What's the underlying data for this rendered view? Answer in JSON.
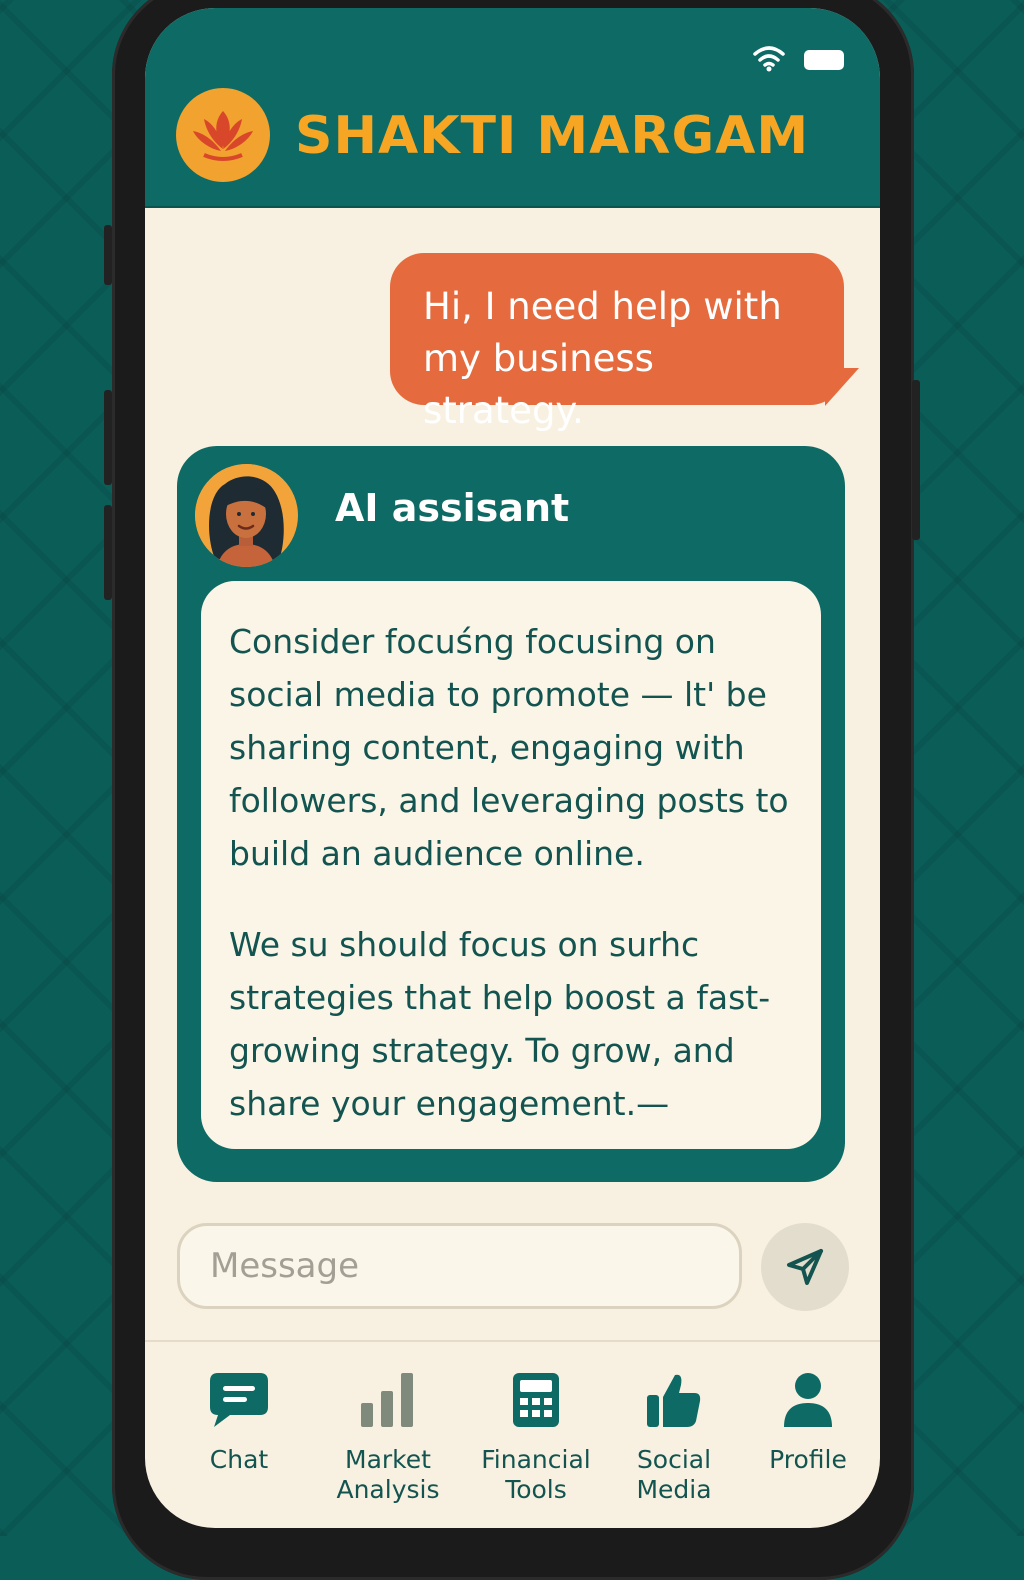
{
  "colors": {
    "background": "#0b5d58",
    "header": "#0e6a64",
    "accent": "#f6a623",
    "user_bubble": "#e56a3d",
    "screen": "#f8f1e1",
    "text_dark": "#135450"
  },
  "status_bar": {
    "icons": [
      "wifi-icon",
      "battery-icon"
    ]
  },
  "header": {
    "title": "SHAKTI MARGAM",
    "logo_icon": "lotus-icon"
  },
  "chat": {
    "user_message": "Hi, I need help with my business strategy.",
    "ai": {
      "name": "AI assisant",
      "avatar_icon": "woman-avatar",
      "paragraphs": [
        "Consider focuśng focusing on social media to promote — lt' be sharing content, engaging with followers, and leveraging posts to build an audience online.",
        "We su should focus on surhc strategies that help boost a fast-growing strategy. To grow, and share your engagement.—"
      ]
    }
  },
  "input": {
    "placeholder": "Message",
    "send_icon": "send-icon"
  },
  "nav": {
    "items": [
      {
        "label": "Chat",
        "icon": "chat-icon"
      },
      {
        "label": "Market\nAnalysis",
        "icon": "bar-chart-icon"
      },
      {
        "label": "Financial\nTools",
        "icon": "calculator-icon"
      },
      {
        "label": "Social\nMedia",
        "icon": "thumbs-up-icon"
      },
      {
        "label": "Profile",
        "icon": "person-icon"
      }
    ]
  }
}
